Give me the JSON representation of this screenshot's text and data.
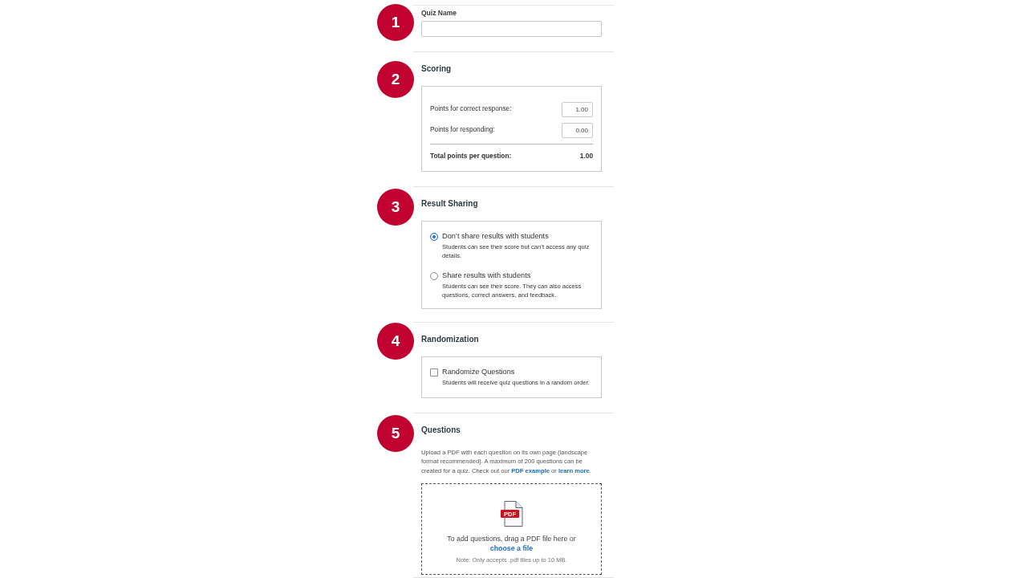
{
  "sections": [
    {
      "kind": "text_field",
      "badge": "1",
      "label": "Quiz Name"
    },
    {
      "kind": "scoring",
      "badge": "2",
      "heading": "Scoring",
      "rows": [
        {
          "label": "Points for correct response:",
          "value": "1.00"
        },
        {
          "label": "Points for responding:",
          "value": "0.00"
        }
      ],
      "total": {
        "label": "Total points per question:",
        "value": "1.00"
      }
    },
    {
      "kind": "radios",
      "badge": "3",
      "heading": "Result Sharing",
      "options": [
        {
          "label": "Don’t share results with students",
          "description": "Students can see their score but can’t access any quiz details.",
          "selected": true
        },
        {
          "label": "Share results with students",
          "description": "Students can see their score. They can also access questions, correct answers, and feedback.",
          "selected": false
        }
      ]
    },
    {
      "kind": "checkboxes",
      "badge": "4",
      "heading": "Randomization",
      "options": [
        {
          "label": "Randomize Questions",
          "description": "Students will receive quiz questions in a random order.",
          "checked": false
        }
      ]
    },
    {
      "kind": "upload",
      "badge": "5",
      "heading": "Questions",
      "intro": [
        {
          "kind": "text",
          "text": "Upload a PDF with each question on its own page (landscape format recommended). A maximum of 200 questions can be created for a quiz. Check out our "
        },
        {
          "kind": "link",
          "text": "PDF example"
        },
        {
          "kind": "text",
          "text": " or "
        },
        {
          "kind": "link",
          "text": "learn more"
        },
        {
          "kind": "text",
          "text": "."
        }
      ],
      "dropzone": {
        "icon_label": "PDF",
        "prompt": [
          {
            "kind": "text",
            "text": "To add questions, drag a PDF file here or "
          },
          {
            "kind": "link",
            "text": "choose a file"
          }
        ],
        "note": "Note: Only accepts .pdf files up to 10 MB."
      }
    }
  ]
}
